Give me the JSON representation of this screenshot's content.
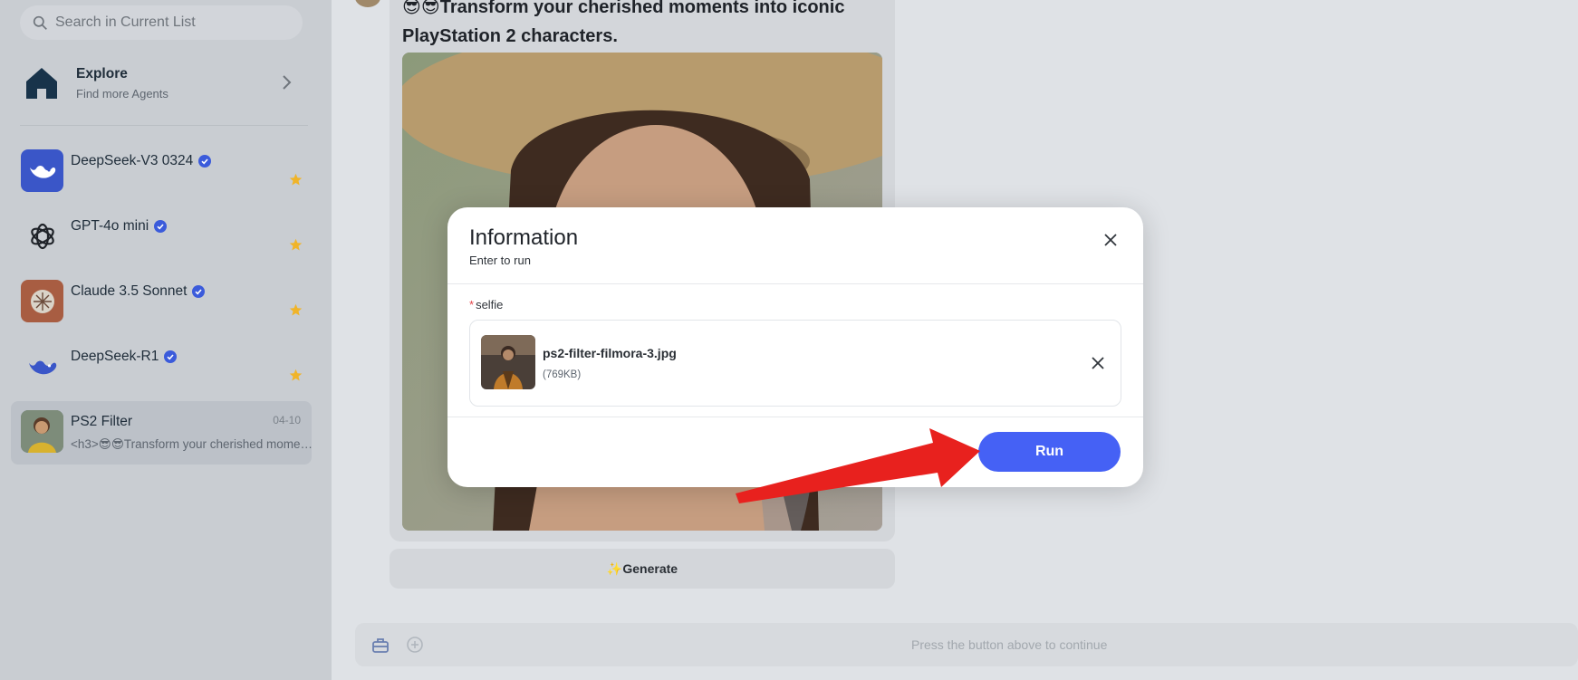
{
  "sidebar": {
    "search": {
      "placeholder": "Search in Current List"
    },
    "explore": {
      "title": "Explore",
      "subtitle": "Find more Agents"
    },
    "agents": [
      {
        "name": "DeepSeek-V3 0324",
        "verified": true,
        "starred": true,
        "icon": "deepseek-whale-icon"
      },
      {
        "name": "GPT-4o mini",
        "verified": true,
        "starred": true,
        "icon": "openai-logo-icon"
      },
      {
        "name": "Claude 3.5 Sonnet",
        "verified": true,
        "starred": true,
        "icon": "claude-logo-icon"
      },
      {
        "name": "DeepSeek-R1",
        "verified": true,
        "starred": true,
        "icon": "deepseek-whale-icon"
      }
    ],
    "active_chat": {
      "name": "PS2 Filter",
      "date": "04-10",
      "preview": "<h3>😎😎Transform your cherished moments into iconic PlayStation 2 characters."
    }
  },
  "chat": {
    "message_title": "😎😎Transform your cherished moments into iconic PlayStation 2 characters.",
    "generate_label": "✨Generate",
    "input_hint": "Press the button above to continue"
  },
  "modal": {
    "title": "Information",
    "subtitle": "Enter to run",
    "field_required_mark": "*",
    "field_label": "selfie",
    "file": {
      "name": "ps2-filter-filmora-3.jpg",
      "size": "(769KB)"
    },
    "run_label": "Run"
  },
  "colors": {
    "accent": "#4561f5",
    "verified": "#3b5bdb",
    "star": "#f0b429",
    "annotation_arrow": "#e8211e"
  }
}
